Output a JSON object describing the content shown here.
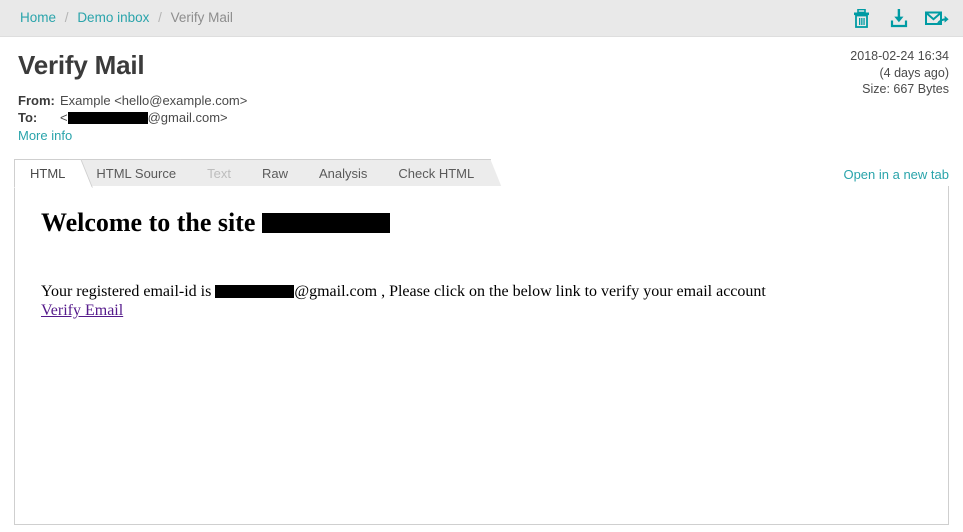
{
  "breadcrumb": {
    "items": [
      {
        "label": "Home",
        "current": false
      },
      {
        "label": "Demo inbox",
        "current": false
      },
      {
        "label": "Verify Mail",
        "current": true
      }
    ],
    "separator": "/"
  },
  "toolbar": {
    "accent_color": "#009ba3",
    "actions": [
      {
        "name": "delete-icon",
        "tooltip": "Delete"
      },
      {
        "name": "download-icon",
        "tooltip": "Download"
      },
      {
        "name": "forward-mail-icon",
        "tooltip": "Forward"
      }
    ]
  },
  "mail": {
    "subject": "Verify Mail",
    "from_label": "From:",
    "from_value": "Example <hello@example.com>",
    "to_label": "To:",
    "to_prefix": "<",
    "to_suffix": "@gmail.com>",
    "more_info_label": "More info",
    "date": "2018-02-24 16:34",
    "relative_date": "(4 days ago)",
    "size": "Size: 667 Bytes"
  },
  "tabs": {
    "items": [
      {
        "label": "HTML",
        "active": true,
        "disabled": false
      },
      {
        "label": "HTML Source",
        "active": false,
        "disabled": false
      },
      {
        "label": "Text",
        "active": false,
        "disabled": true
      },
      {
        "label": "Raw",
        "active": false,
        "disabled": false
      },
      {
        "label": "Analysis",
        "active": false,
        "disabled": false
      },
      {
        "label": "Check HTML",
        "active": false,
        "disabled": false
      }
    ],
    "open_new_tab_label": "Open in a new tab"
  },
  "body": {
    "heading_prefix": "Welcome to the site ",
    "paragraph_prefix": "Your registered email-id is ",
    "paragraph_suffix": "@gmail.com , Please click on the below link to verify your email account",
    "verify_link_label": "Verify Email",
    "link_color": "#551a8b"
  }
}
